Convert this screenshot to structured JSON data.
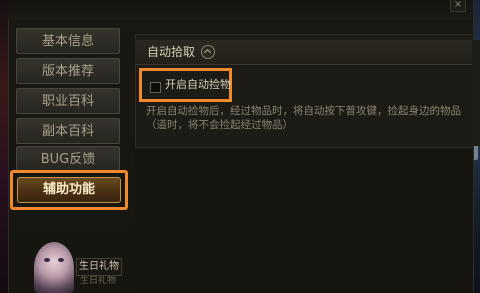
{
  "sidebar": {
    "items": [
      {
        "label": "基本信息"
      },
      {
        "label": "版本推荐"
      },
      {
        "label": "职业百科"
      },
      {
        "label": "副本百科"
      },
      {
        "label": "BUG反馈"
      },
      {
        "label": "辅助功能"
      }
    ],
    "active_index": 5
  },
  "gift": {
    "label": "生日礼物",
    "sub": "生日礼物"
  },
  "section": {
    "title": "自动拾取"
  },
  "option": {
    "label": "开启自动捡物",
    "checked": false
  },
  "description": "开启自动捡物后，经过物品时，将自动按下普攻键，捡起身边的物品（道时，将不会捡起经过物品）",
  "close_symbol": "×",
  "colors": {
    "highlight": "#f08a2c",
    "active_button": "#4a3014"
  }
}
